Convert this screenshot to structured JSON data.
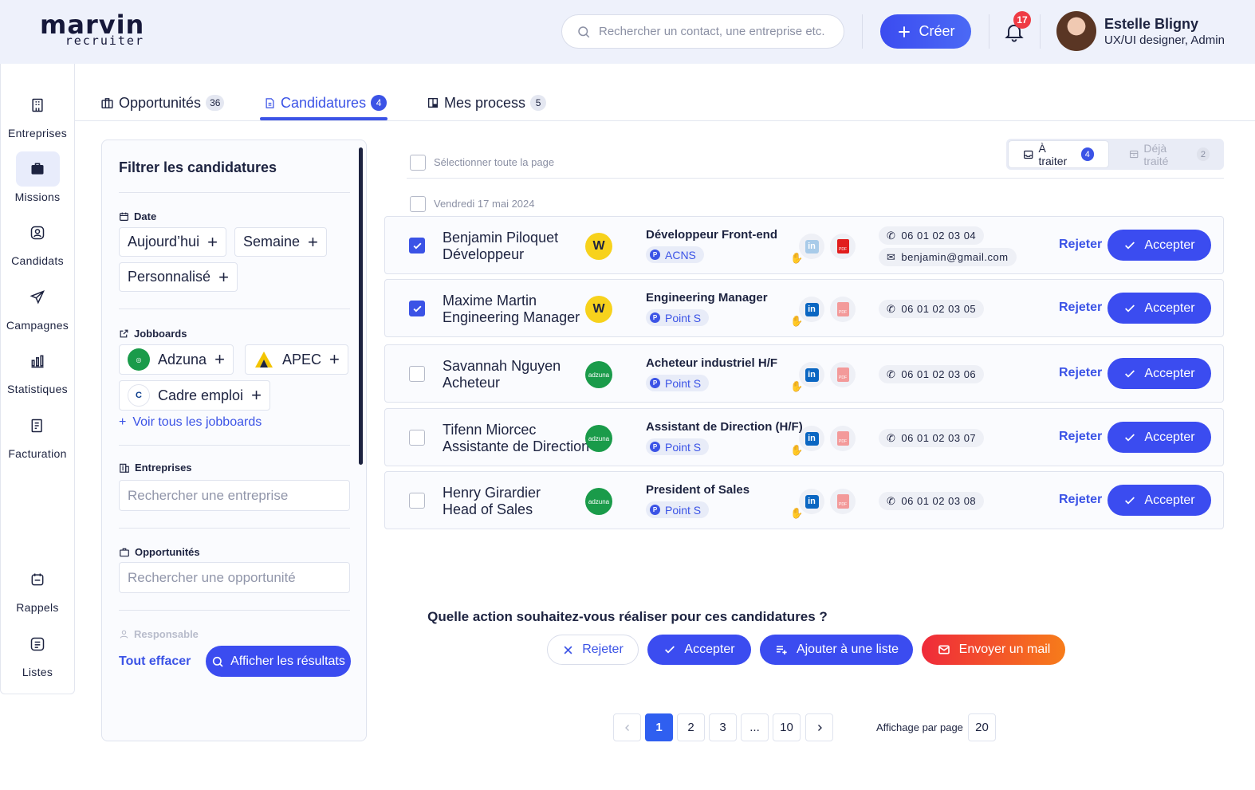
{
  "brand": {
    "name": "marvin",
    "sub": "recruiter"
  },
  "header": {
    "search_placeholder": "Rechercher un contact, une entreprise etc.",
    "create_label": "Créer",
    "notif_count": "17",
    "user_name": "Estelle Bligny",
    "user_role": "UX/UI designer, Admin"
  },
  "sidebar": {
    "items": [
      {
        "label": "Entreprises",
        "icon": "building-icon"
      },
      {
        "label": "Missions",
        "icon": "briefcase-icon",
        "active": true
      },
      {
        "label": "Candidats",
        "icon": "user-icon"
      },
      {
        "label": "Campagnes",
        "icon": "send-icon"
      },
      {
        "label": "Statistiques",
        "icon": "bar-chart-icon"
      },
      {
        "label": "Facturation",
        "icon": "invoice-icon"
      },
      {
        "label": "Rappels",
        "icon": "reminder-icon"
      },
      {
        "label": "Listes",
        "icon": "list-icon"
      }
    ]
  },
  "tabs": [
    {
      "label": "Opportunités",
      "count": "36"
    },
    {
      "label": "Candidatures",
      "count": "4",
      "active": true
    },
    {
      "label": "Mes process",
      "count": "5"
    }
  ],
  "filters": {
    "title": "Filtrer les candidatures",
    "date_label": "Date",
    "date_chips": [
      "Aujourd’hui",
      "Semaine",
      "Personnalisé"
    ],
    "jobboards_label": "Jobboards",
    "jobboards": [
      "Adzuna",
      "APEC",
      "Cadre emploi"
    ],
    "see_all": "Voir tous les jobboards",
    "companies_label": "Entreprises",
    "companies_placeholder": "Rechercher une entreprise",
    "opps_label": "Opportunités",
    "opps_placeholder": "Rechercher une opportunité",
    "owner_label": "Responsable",
    "clear_label": "Tout effacer",
    "show_label": "Afficher les résultats"
  },
  "list": {
    "select_all": "Sélectionner toute la page",
    "date_group": "Vendredi 17 mai 2024",
    "toggle": {
      "todo_label": "À traiter",
      "todo_count": "4",
      "done_label": "Déjà traité",
      "done_count": "2"
    },
    "reject_label": "Rejeter",
    "accept_label": "Accepter",
    "rows": [
      {
        "name": "Benjamin Piloquet",
        "job": "Développeur",
        "source": "W",
        "position": "Développeur Front-end",
        "company": "ACNS",
        "phone": "06 01 02 03 04",
        "email": "benjamin@gmail.com",
        "checked": true
      },
      {
        "name": "Maxime Martin",
        "job": "Engineering Manager",
        "source": "W",
        "position": "Engineering Manager",
        "company": "Point S",
        "phone": "06 01 02 03 05",
        "checked": true
      },
      {
        "name": "Savannah Nguyen",
        "job": "Acheteur",
        "source": "adzuna",
        "position": "Acheteur industriel H/F",
        "company": "Point S",
        "phone": "06 01 02 03 06",
        "checked": false
      },
      {
        "name": "Tifenn Miorcec",
        "job": "Assistante de Direction",
        "source": "adzuna",
        "position": "Assistant de Direction (H/F)",
        "company": "Point S",
        "phone": "06 01 02 03 07",
        "checked": false
      },
      {
        "name": "Henry Girardier",
        "job": "Head of Sales",
        "source": "adzuna",
        "position": "President of Sales",
        "company": "Point S",
        "phone": "06 01 02 03 08",
        "checked": false
      }
    ]
  },
  "bulk": {
    "question": "Quelle action souhaitez-vous réaliser pour ces candidatures ?",
    "reject": "Rejeter",
    "accept": "Accepter",
    "add_list": "Ajouter à une liste",
    "send_mail": "Envoyer un mail"
  },
  "pagination": {
    "pages": [
      "1",
      "2",
      "3",
      "...",
      "10"
    ],
    "current": "1",
    "per_page_label": "Affichage par page",
    "per_page": "20"
  },
  "colors": {
    "accent": "#3b53e6",
    "danger": "#ef3b44",
    "mail_from": "#ef2a3a",
    "mail_to": "#f77c1a"
  }
}
